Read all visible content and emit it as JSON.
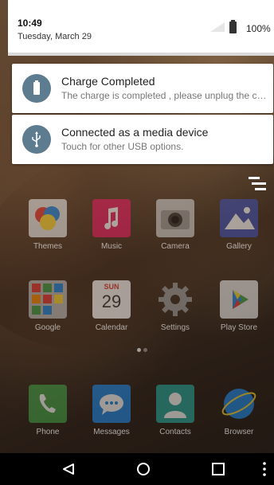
{
  "status": {
    "time": "10:49",
    "date": "Tuesday, March 29",
    "battery_percent": "100%"
  },
  "notifications": [
    {
      "icon": "battery-icon",
      "title": "Charge Completed",
      "text": "The charge is completed , please unplug the ch.."
    },
    {
      "icon": "usb-icon",
      "title": "Connected as a media device",
      "text": "Touch for other USB options."
    }
  ],
  "apps_row1": [
    {
      "label": "Themes",
      "icon": "themes-icon"
    },
    {
      "label": "Music",
      "icon": "music-icon"
    },
    {
      "label": "Camera",
      "icon": "camera-icon"
    },
    {
      "label": "Gallery",
      "icon": "gallery-icon"
    }
  ],
  "apps_row2": [
    {
      "label": "Google",
      "icon": "google-folder-icon"
    },
    {
      "label": "Calendar",
      "icon": "calendar-icon",
      "day": "SUN",
      "date": "29"
    },
    {
      "label": "Settings",
      "icon": "gear-icon"
    },
    {
      "label": "Play Store",
      "icon": "play-store-icon"
    }
  ],
  "dock": [
    {
      "label": "Phone",
      "icon": "phone-icon"
    },
    {
      "label": "Messages",
      "icon": "messages-icon"
    },
    {
      "label": "Contacts",
      "icon": "contacts-icon"
    },
    {
      "label": "Browser",
      "icon": "browser-icon"
    }
  ],
  "colors": {
    "notification_icon_bg": "#5d7c90",
    "navbar_bg": "#000000"
  }
}
